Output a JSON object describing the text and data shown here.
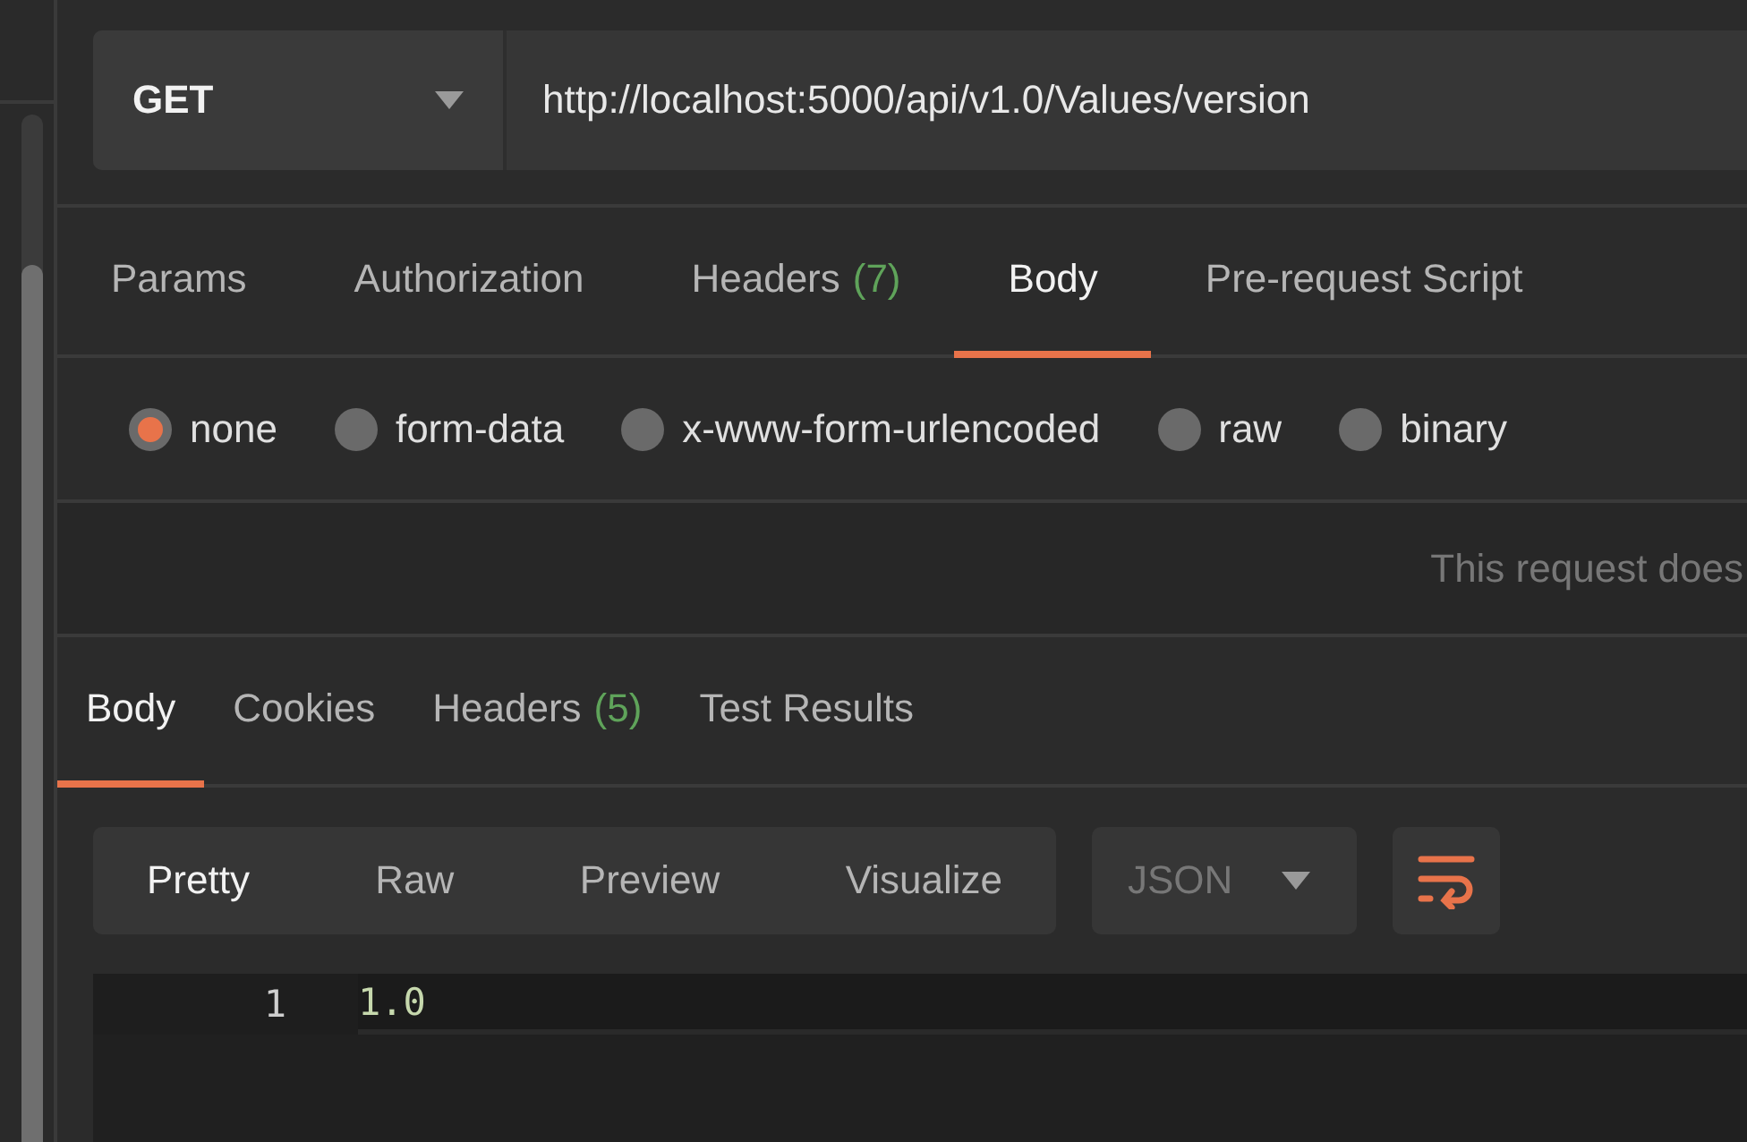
{
  "request": {
    "method": "GET",
    "url": "http://localhost:5000/api/v1.0/Values/version"
  },
  "request_tabs": [
    {
      "label": "Params",
      "selected": false
    },
    {
      "label": "Authorization",
      "selected": false
    },
    {
      "label": "Headers",
      "count": "(7)",
      "selected": false
    },
    {
      "label": "Body",
      "selected": true
    },
    {
      "label": "Pre-request Script",
      "selected": false
    }
  ],
  "body_types": [
    {
      "label": "none",
      "selected": true
    },
    {
      "label": "form-data",
      "selected": false
    },
    {
      "label": "x-www-form-urlencoded",
      "selected": false
    },
    {
      "label": "raw",
      "selected": false
    },
    {
      "label": "binary",
      "selected": false
    }
  ],
  "body_message": "This request does",
  "response_tabs": [
    {
      "label": "Body",
      "selected": true
    },
    {
      "label": "Cookies",
      "selected": false
    },
    {
      "label": "Headers",
      "count": "(5)",
      "selected": false
    },
    {
      "label": "Test Results",
      "selected": false
    }
  ],
  "view_modes": [
    {
      "label": "Pretty",
      "selected": true
    },
    {
      "label": "Raw",
      "selected": false
    },
    {
      "label": "Preview",
      "selected": false
    },
    {
      "label": "Visualize",
      "selected": false
    }
  ],
  "format": "JSON",
  "wrap_lines": true,
  "code_lines": [
    {
      "number": "1",
      "text": "1.0"
    }
  ]
}
